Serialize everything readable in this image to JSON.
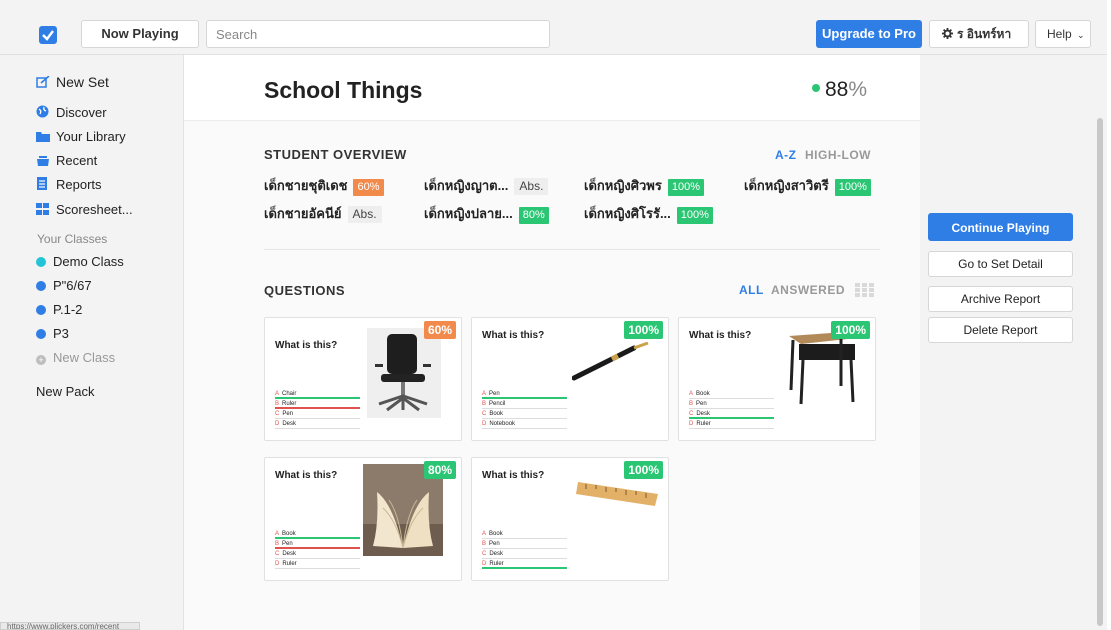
{
  "topbar": {
    "logo_icon": "checkbox-logo-icon",
    "now_playing_label": "Now Playing",
    "search_placeholder": "Search",
    "upgrade_label": "Upgrade to Pro",
    "account_label": "ร อินทร์หา",
    "account_icon": "gear-icon",
    "help_label": "Help",
    "help_icon": "chevron-down-icon"
  },
  "sidebar": {
    "items": [
      {
        "label": "New Set",
        "icon": "edit-icon"
      },
      {
        "label": "Discover",
        "icon": "globe-icon"
      },
      {
        "label": "Your Library",
        "icon": "folder-icon"
      },
      {
        "label": "Recent",
        "icon": "recent-icon"
      },
      {
        "label": "Reports",
        "icon": "report-icon"
      },
      {
        "label": "Scoresheet...",
        "icon": "grid-icon"
      }
    ],
    "classes_heading": "Your Classes",
    "classes": [
      {
        "label": "Demo Class",
        "color": "#23c4d7"
      },
      {
        "label": "P\"6/67",
        "color": "#2f7ee6"
      },
      {
        "label": "P.1-2",
        "color": "#2f7ee6"
      },
      {
        "label": "P3",
        "color": "#2f7ee6"
      }
    ],
    "new_class_label": "New Class",
    "new_pack_label": "New Pack",
    "status_url": "https://www.plickers.com/recent"
  },
  "main": {
    "title": "School Things",
    "score_value": "88",
    "score_unit": "%",
    "student_overview": {
      "heading": "STUDENT OVERVIEW",
      "sort_az": "A-Z",
      "sort_high_low": "HIGH-LOW",
      "students": [
        {
          "name": "เด็กชายชุติเดช",
          "score": "60%",
          "kind": "orange"
        },
        {
          "name": "เด็กหญิงญาต...",
          "score": "Abs.",
          "kind": "abs"
        },
        {
          "name": "เด็กหญิงศิวพร",
          "score": "100%",
          "kind": "green"
        },
        {
          "name": "เด็กหญิงสาวิตรี",
          "score": "100%",
          "kind": "green"
        },
        {
          "name": "เด็กชายอัคนีย์",
          "score": "Abs.",
          "kind": "abs"
        },
        {
          "name": "เด็กหญิงปลาย...",
          "score": "80%",
          "kind": "green"
        },
        {
          "name": "เด็กหญิงศิโรรั...",
          "score": "100%",
          "kind": "green"
        }
      ]
    },
    "questions": {
      "heading": "QUESTIONS",
      "filter_all": "ALL",
      "filter_answered": "ANSWERED",
      "grid_icon": "grid-view-icon",
      "cards": [
        {
          "question": "What is this?",
          "score": "60%",
          "kind": "orange",
          "image": "office-chair-image",
          "choices": [
            {
              "letter": "A",
              "text": "Chair"
            },
            {
              "letter": "B",
              "text": "Ruler"
            },
            {
              "letter": "C",
              "text": "Pen"
            },
            {
              "letter": "D",
              "text": "Desk"
            }
          ]
        },
        {
          "question": "What is this?",
          "score": "100%",
          "kind": "green",
          "image": "pen-image",
          "choices": [
            {
              "letter": "A",
              "text": "Pen"
            },
            {
              "letter": "B",
              "text": "Pencil"
            },
            {
              "letter": "C",
              "text": "Book"
            },
            {
              "letter": "D",
              "text": "Notebook"
            }
          ]
        },
        {
          "question": "What is this?",
          "score": "100%",
          "kind": "green",
          "image": "school-desk-image",
          "choices": [
            {
              "letter": "A",
              "text": "Book"
            },
            {
              "letter": "B",
              "text": "Pen"
            },
            {
              "letter": "C",
              "text": "Desk"
            },
            {
              "letter": "D",
              "text": "Ruler"
            }
          ]
        },
        {
          "question": "What is this?",
          "score": "80%",
          "kind": "green",
          "image": "open-book-image",
          "choices": [
            {
              "letter": "A",
              "text": "Book"
            },
            {
              "letter": "B",
              "text": "Pen"
            },
            {
              "letter": "C",
              "text": "Desk"
            },
            {
              "letter": "D",
              "text": "Ruler"
            }
          ]
        },
        {
          "question": "What is this?",
          "score": "100%",
          "kind": "green",
          "image": "ruler-image",
          "choices": [
            {
              "letter": "A",
              "text": "Book"
            },
            {
              "letter": "B",
              "text": "Pen"
            },
            {
              "letter": "C",
              "text": "Desk"
            },
            {
              "letter": "D",
              "text": "Ruler"
            }
          ]
        }
      ]
    }
  },
  "right_panel": {
    "continue_label": "Continue Playing",
    "detail_label": "Go to Set Detail",
    "archive_label": "Archive Report",
    "delete_label": "Delete Report"
  },
  "colors": {
    "accent_blue": "#2f7ee6",
    "correct_green": "#2bc673",
    "warn_orange": "#f28a4b",
    "letter_red": "#e0534d"
  }
}
